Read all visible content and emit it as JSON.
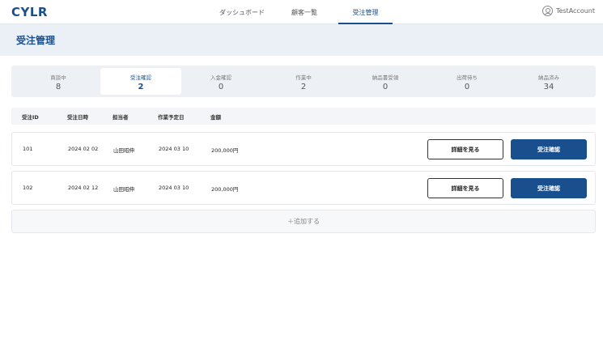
{
  "app": {
    "logo": "CYLR"
  },
  "nav": {
    "tabs": [
      {
        "label": "ダッシュボード",
        "active": false
      },
      {
        "label": "顧客一覧",
        "active": false
      },
      {
        "label": "受注管理",
        "active": true
      }
    ]
  },
  "account": {
    "name": "TestAccount",
    "icon": "user-circle-icon"
  },
  "page": {
    "title": "受注管理"
  },
  "statuses": [
    {
      "label": "商談中",
      "count": "8",
      "active": false
    },
    {
      "label": "受注確認",
      "count": "2",
      "active": true
    },
    {
      "label": "入金確認",
      "count": "0",
      "active": false
    },
    {
      "label": "作業中",
      "count": "2",
      "active": false
    },
    {
      "label": "納品書受領",
      "count": "0",
      "active": false
    },
    {
      "label": "出荷待ち",
      "count": "0",
      "active": false
    },
    {
      "label": "納品済み",
      "count": "34",
      "active": false
    }
  ],
  "table": {
    "headers": [
      "受注ID",
      "受注日時",
      "担当者",
      "作業予定日",
      "金額"
    ],
    "rows": [
      {
        "id": "101",
        "date": "2024 02 02",
        "staff": "山田昭伸",
        "scheduled": "2024 03 10",
        "amount": "200,000円",
        "detail_label": "詳細を見る",
        "confirm_label": "受注確認"
      },
      {
        "id": "102",
        "date": "2024 02 12",
        "staff": "山田昭伸",
        "scheduled": "2024 03 10",
        "amount": "200,000円",
        "detail_label": "詳細を見る",
        "confirm_label": "受注確認"
      }
    ],
    "add_label": "＋追加する"
  },
  "colors": {
    "accent": "#1a4f8e",
    "header_band": "#ebf0f7",
    "status_bar": "#edf1f6"
  }
}
